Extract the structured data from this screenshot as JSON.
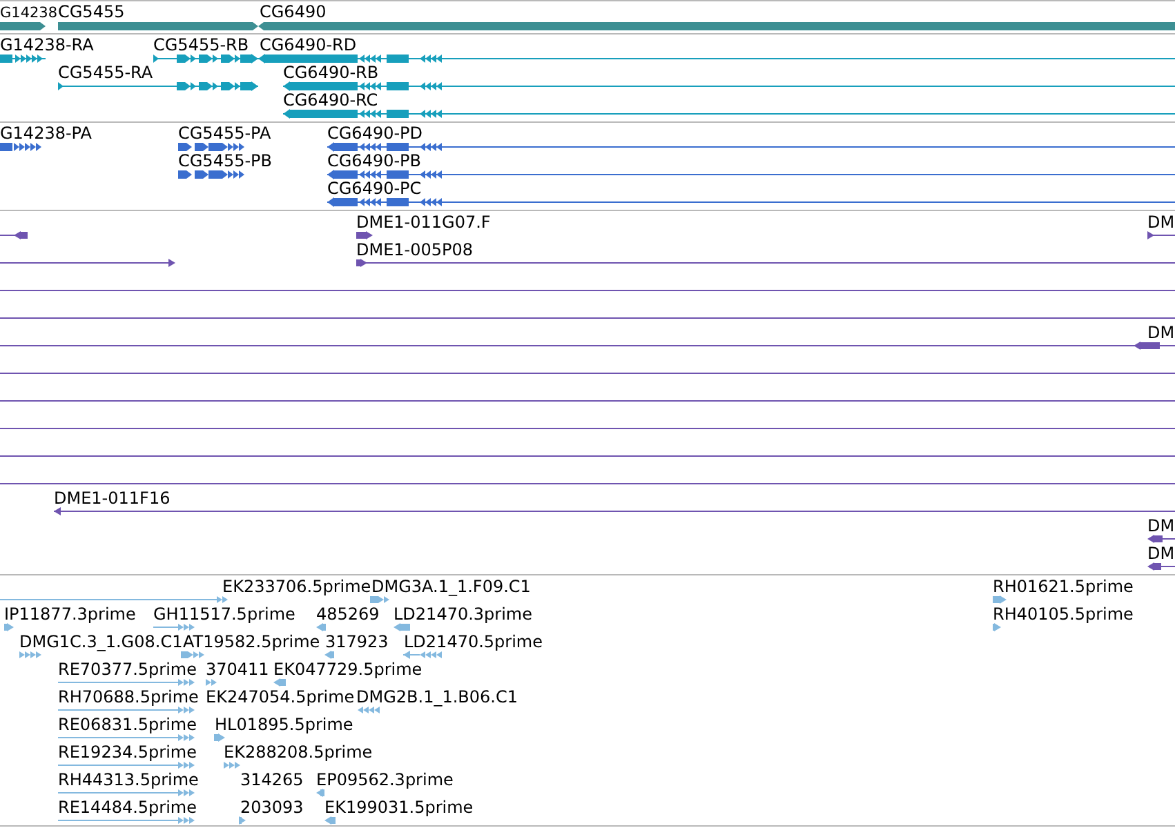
{
  "tracks": [
    {
      "kind": "genes",
      "color": "#3d8f93",
      "features": [
        {
          "label": "G14238",
          "reverse": false
        },
        {
          "label": "CG5455",
          "reverse": false
        },
        {
          "label": "CG6490",
          "reverse": true
        }
      ]
    },
    {
      "kind": "transcripts",
      "color": "#179fbc",
      "features": [
        {
          "label": "G14238-RA",
          "reverse": false
        },
        {
          "label": "CG5455-RB",
          "reverse": false
        },
        {
          "label": "CG6490-RD",
          "reverse": true
        },
        {
          "label": "CG5455-RA",
          "reverse": false
        },
        {
          "label": "CG6490-RB",
          "reverse": true
        },
        {
          "label": "CG6490-RC",
          "reverse": true
        }
      ]
    },
    {
      "kind": "proteins",
      "color": "#3a6ecf",
      "features": [
        {
          "label": "G14238-PA",
          "reverse": false
        },
        {
          "label": "CG5455-PA",
          "reverse": false
        },
        {
          "label": "CG6490-PD",
          "reverse": true
        },
        {
          "label": "CG5455-PB",
          "reverse": false
        },
        {
          "label": "CG6490-PB",
          "reverse": true
        },
        {
          "label": "CG6490-PC",
          "reverse": true
        }
      ]
    },
    {
      "kind": "alignments",
      "color": "#6f54b0",
      "features": [
        {
          "kind": "feature",
          "reverse": true
        },
        {
          "kind": "feature",
          "label": "DME1-011G07.F",
          "reverse": false
        },
        {
          "kind": "feature",
          "label": "DM",
          "reverse": false
        },
        {
          "kind": "feature",
          "reverse": false
        },
        {
          "kind": "feature",
          "label": "DME1-005P08",
          "reverse": false
        },
        {
          "kind": "span"
        },
        {
          "kind": "span"
        },
        {
          "kind": "span"
        },
        {
          "kind": "feature",
          "label": "DM",
          "reverse": true
        },
        {
          "kind": "span"
        },
        {
          "kind": "span"
        },
        {
          "kind": "span"
        },
        {
          "kind": "span"
        },
        {
          "kind": "span"
        },
        {
          "kind": "feature",
          "label": "DME1-011F16",
          "reverse": true
        },
        {
          "kind": "feature",
          "label": "DM",
          "reverse": true
        },
        {
          "kind": "feature",
          "label": "DM",
          "reverse": true
        }
      ]
    },
    {
      "kind": "ests",
      "color": "#84b9df",
      "features": [
        {
          "label": "EK233706.5prime",
          "reverse": false
        },
        {
          "label": "DMG3A.1_1.F09.C1",
          "reverse": false
        },
        {
          "label": "RH01621.5prime",
          "reverse": false
        },
        {
          "label": "IP11877.3prime",
          "reverse": false
        },
        {
          "label": "GH11517.5prime",
          "reverse": false
        },
        {
          "label": "485269",
          "reverse": true
        },
        {
          "label": "LD21470.3prime",
          "reverse": true
        },
        {
          "label": "RH40105.5prime",
          "reverse": false
        },
        {
          "label": "DMG1C.3_1.G08.C1",
          "reverse": false
        },
        {
          "label": "AT19582.5prime",
          "reverse": false
        },
        {
          "label": "317923",
          "reverse": true
        },
        {
          "label": "LD21470.5prime",
          "reverse": true
        },
        {
          "label": "RE70377.5prime",
          "reverse": false
        },
        {
          "label": "370411",
          "reverse": false
        },
        {
          "label": "EK047729.5prime",
          "reverse": true
        },
        {
          "label": "RH70688.5prime",
          "reverse": false
        },
        {
          "label": "EK247054.5prime"
        },
        {
          "label": "DMG2B.1_1.B06.C1",
          "reverse": true
        },
        {
          "label": "RE06831.5prime",
          "reverse": false
        },
        {
          "label": "HL01895.5prime",
          "reverse": false
        },
        {
          "label": "RE19234.5prime",
          "reverse": false
        },
        {
          "label": "EK288208.5prime",
          "reverse": false
        },
        {
          "label": "RH44313.5prime",
          "reverse": false
        },
        {
          "label": "314265"
        },
        {
          "label": "EP09562.3prime",
          "reverse": true
        },
        {
          "label": "RE14484.5prime",
          "reverse": false
        },
        {
          "label": "203093",
          "reverse": false
        },
        {
          "label": "EK199031.5prime",
          "reverse": true
        }
      ]
    }
  ]
}
